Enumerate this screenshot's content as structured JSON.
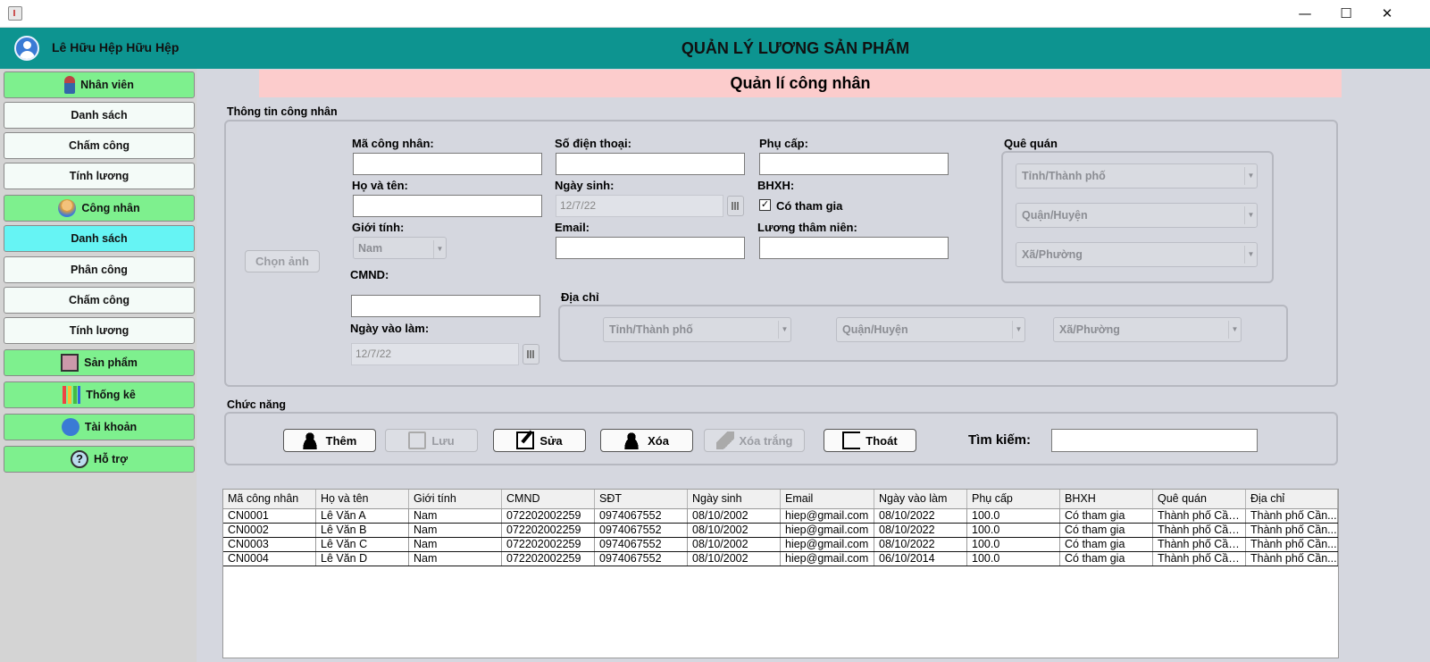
{
  "window": {
    "minimize": "—",
    "maximize": "☐",
    "close": "✕"
  },
  "header": {
    "user_name": "Lê Hữu Hệp Hữu Hệp",
    "title": "QUẢN LÝ LƯƠNG SẢN PHẨM"
  },
  "sidebar": {
    "items": [
      {
        "label": "Nhân viên",
        "icon": "employee-icon"
      },
      {
        "label": "Danh sách"
      },
      {
        "label": "Chấm công"
      },
      {
        "label": "Tính lương"
      },
      {
        "label": "Công nhân",
        "icon": "worker-icon"
      },
      {
        "label": "Danh sách"
      },
      {
        "label": "Phân công"
      },
      {
        "label": "Chấm công"
      },
      {
        "label": "Tính lương"
      },
      {
        "label": "Sản phẩm",
        "icon": "product-icon"
      },
      {
        "label": "Thống kê",
        "icon": "chart-icon"
      },
      {
        "label": "Tài khoản",
        "icon": "account-icon"
      },
      {
        "label": "Hỗ trợ",
        "icon": "help-icon"
      }
    ]
  },
  "page": {
    "title": "Quản lí công nhân"
  },
  "info": {
    "group_label": "Thông tin công nhân",
    "choose_photo": "Chọn ảnh",
    "ma_label": "Mã công nhân:",
    "ma_value": "",
    "hoten_label": "Họ và tên:",
    "hoten_value": "",
    "gioitinh_label": "Giới tính:",
    "gioitinh_value": "Nam",
    "cmnd_label": "CMND:",
    "cmnd_value": "",
    "ngayvaolam_label": "Ngày vào làm:",
    "ngayvaolam_value": "12/7/22",
    "sdt_label": "Số điện thoại:",
    "sdt_value": "",
    "ngaysinh_label": "Ngày sinh:",
    "ngaysinh_value": "12/7/22",
    "email_label": "Email:",
    "email_value": "",
    "phucap_label": "Phụ cấp:",
    "phucap_value": "",
    "bhxh_label": "BHXH:",
    "bhxh_check": "Có tham gia",
    "bhxh_checked": "✓",
    "luong_label": "Lương thâm niên:",
    "luong_value": "",
    "quequan_label": "Quê quán",
    "quequan_tinh": "Tỉnh/Thành phố",
    "quequan_huyen": "Quận/Huyện",
    "quequan_xa": "Xã/Phường",
    "diachi_label": "Địa chỉ",
    "diachi_tinh": "Tỉnh/Thành phố",
    "diachi_huyen": "Quận/Huyện",
    "diachi_xa": "Xã/Phường"
  },
  "actions": {
    "group_label": "Chức năng",
    "add": "Thêm",
    "save": "Lưu",
    "edit": "Sửa",
    "delete": "Xóa",
    "clear": "Xóa trắng",
    "exit": "Thoát",
    "search_label": "Tìm kiếm:",
    "search_value": ""
  },
  "table": {
    "columns": [
      "Mã công nhân",
      "Họ và tên",
      "Giới tính",
      "CMND",
      "SĐT",
      "Ngày sinh",
      "Email",
      "Ngày vào làm",
      "Phụ cấp",
      "BHXH",
      "Quê quán",
      "Địa chỉ"
    ],
    "rows": [
      [
        "CN0001",
        "Lê Văn A",
        "Nam",
        "072202002259",
        "0974067552",
        "08/10/2002",
        "hiep@gmail.com",
        "08/10/2022",
        "100.0",
        "Có tham gia",
        "Thành phố Cần ...",
        "Thành phố Cần..."
      ],
      [
        "CN0002",
        "Lê Văn B",
        "Nam",
        "072202002259",
        "0974067552",
        "08/10/2002",
        "hiep@gmail.com",
        "08/10/2022",
        "100.0",
        "Có tham gia",
        "Thành phố Cần ...",
        "Thành phố Cần..."
      ],
      [
        "CN0003",
        "Lê Văn C",
        "Nam",
        "072202002259",
        "0974067552",
        "08/10/2002",
        "hiep@gmail.com",
        "08/10/2022",
        "100.0",
        "Có tham gia",
        "Thành phố Cần ...",
        "Thành phố Cần..."
      ],
      [
        "CN0004",
        "Lê Văn D",
        "Nam",
        "072202002259",
        "0974067552",
        "08/10/2002",
        "hiep@gmail.com",
        "06/10/2014",
        "100.0",
        "Có tham gia",
        "Thành phố Cần ...",
        "Thành phố Cần..."
      ]
    ]
  },
  "colors": {
    "header": "#0d9490",
    "nav_green": "#7ef08e",
    "nav_active": "#66f4f4",
    "banner": "#fccccc"
  }
}
